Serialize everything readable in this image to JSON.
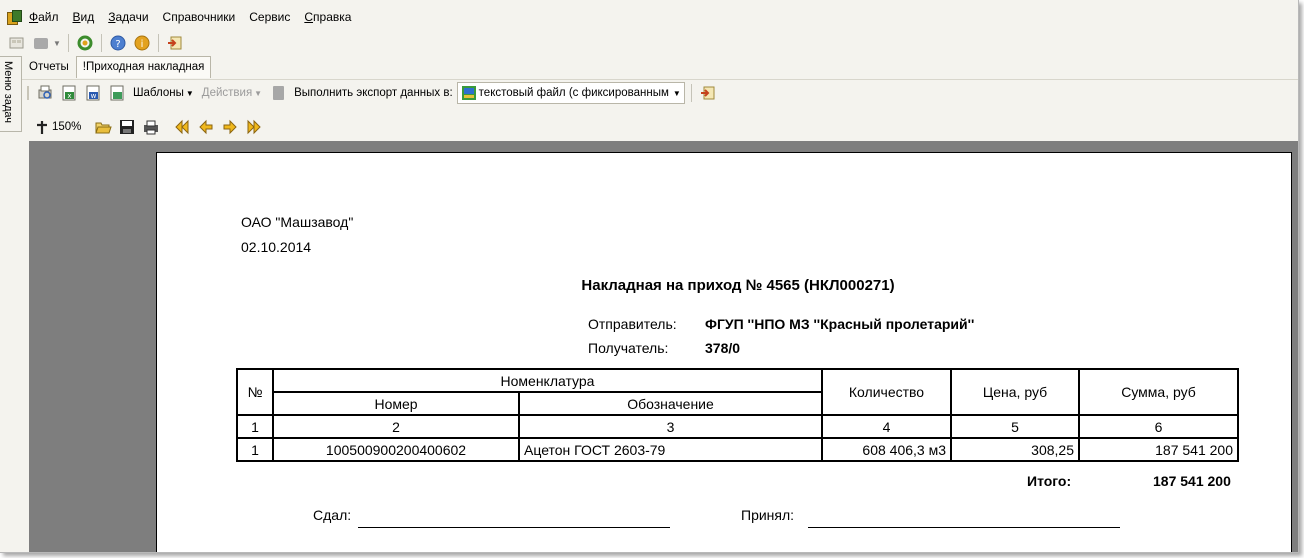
{
  "menu": {
    "items": [
      {
        "accel": "Ф",
        "rest": "айл"
      },
      {
        "accel": "В",
        "rest": "ид"
      },
      {
        "accel": "З",
        "rest": "адачи"
      },
      {
        "accel": "",
        "rest": "Справочники"
      },
      {
        "accel": "",
        "rest": "Сервис"
      },
      {
        "accel": "С",
        "rest": "правка"
      }
    ]
  },
  "sidebar": {
    "label": "Меню задач"
  },
  "tabs": [
    "Отчеты",
    "!Приходная накладная"
  ],
  "report_toolbar": {
    "templates_label": "Шаблоны",
    "actions_label": "Действия",
    "export_label": "Выполнить экспорт данных в:",
    "export_target": "текстовый файл (с фиксированным"
  },
  "preview_toolbar": {
    "zoom": "150%"
  },
  "document": {
    "org": "ОАО \"Машзавод\"",
    "date": "02.10.2014",
    "title": "Накладная на приход № 4565 (НКЛ000271)",
    "sender_label": "Отправитель:",
    "sender_value": "ФГУП ''НПО МЗ ''Красный пролетарий''",
    "receiver_label": "Получатель:",
    "receiver_value": "378/0",
    "table": {
      "col_no": "№",
      "col_nomenclature": "Номенклатура",
      "col_number": "Номер",
      "col_designation": "Обозначение",
      "col_qty": "Количество",
      "col_price": "Цена, руб",
      "col_sum": "Сумма, руб",
      "index_row": [
        "1",
        "2",
        "3",
        "4",
        "5",
        "6"
      ],
      "rows": [
        {
          "no": "1",
          "number": "100500900200400602",
          "designation": "Ацетон ГОСТ 2603-79",
          "qty": "608 406,3 м3",
          "price": "308,25",
          "sum": "187 541 200"
        }
      ]
    },
    "total_label": "Итого:",
    "total_value": "187 541 200",
    "handed_label": "Сдал:",
    "accepted_label": "Принял:"
  }
}
